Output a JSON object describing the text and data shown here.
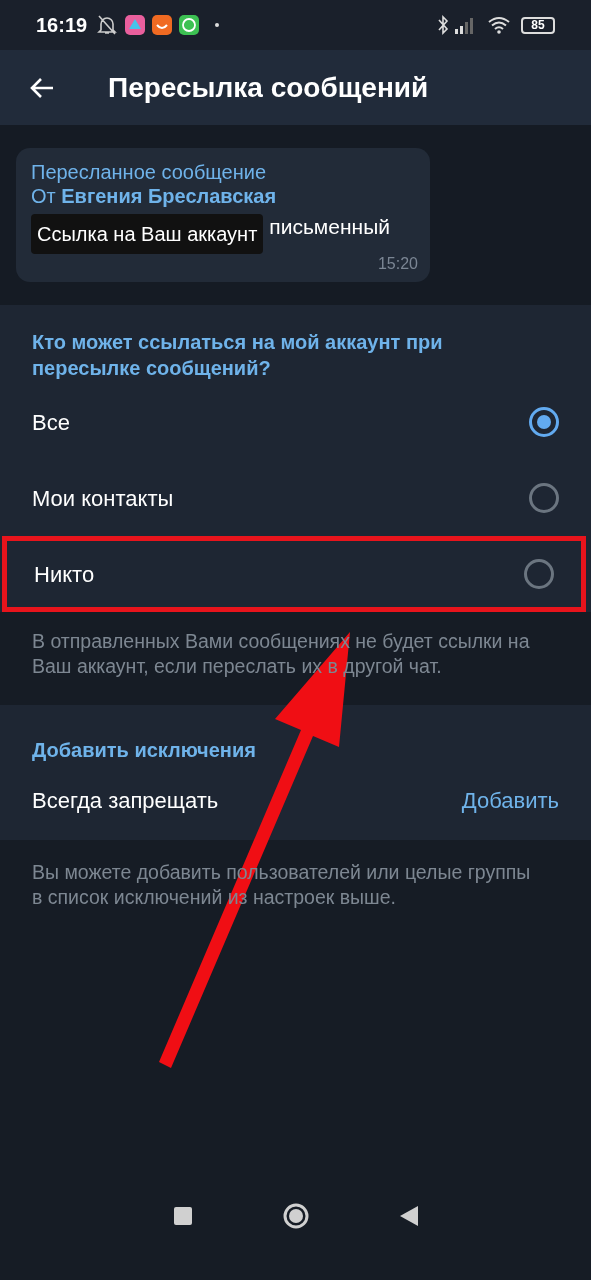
{
  "status_bar": {
    "time": "16:19",
    "battery": "85"
  },
  "header": {
    "title": "Пересылка сообщений"
  },
  "preview": {
    "forwarded_label": "Пересланное сообщение",
    "from_prefix": "От",
    "from_name": "Евгения Бреславская",
    "message": "письменный",
    "time": "15:20",
    "tooltip": "Ссылка на Ваш аккаунт"
  },
  "privacy": {
    "heading": "Кто может ссылаться на мой аккаунт при пересылке сообщений?",
    "options": [
      {
        "label": "Все",
        "selected": true,
        "highlighted": false
      },
      {
        "label": "Мои контакты",
        "selected": false,
        "highlighted": false
      },
      {
        "label": "Никто",
        "selected": false,
        "highlighted": true
      }
    ],
    "note": "В отправленных Вами сообщениях не будет ссылки на Ваш аккаунт, если переслать их в другой чат."
  },
  "exceptions": {
    "heading": "Добавить исключения",
    "rows": [
      {
        "label": "Всегда запрещать",
        "action": "Добавить"
      }
    ],
    "note": "Вы можете добавить пользователей или целые группы в список исключений из настроек выше."
  },
  "annotation": {
    "arrow": true
  }
}
